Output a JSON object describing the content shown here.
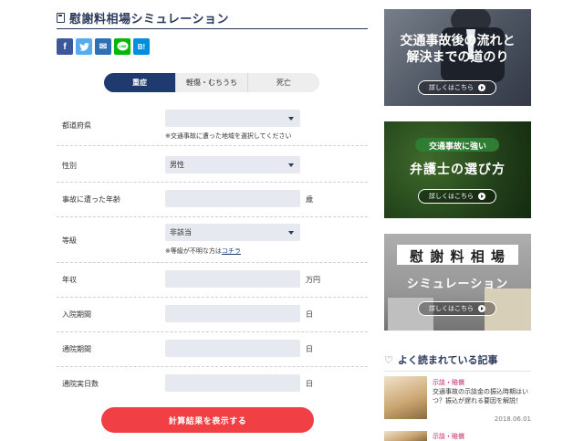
{
  "page_title": "慰謝料相場シミュレーション",
  "share": {
    "facebook": "f",
    "twitter": "t",
    "mail": "✉",
    "line": "LINE",
    "hatena": "B!"
  },
  "tabs": [
    {
      "label": "重症",
      "active": true
    },
    {
      "label": "軽傷・むちうち",
      "active": false
    },
    {
      "label": "死亡",
      "active": false
    }
  ],
  "form": {
    "prefecture": {
      "label": "都道府県",
      "value": "",
      "note": "※交通事故に遭った地域を選択してください"
    },
    "gender": {
      "label": "性別",
      "value": "男性"
    },
    "age": {
      "label": "事故に遭った年齢",
      "value": "",
      "unit": "歳"
    },
    "grade": {
      "label": "等級",
      "value": "非該当",
      "note_prefix": "※等級が不明な方は",
      "note_link": "コチラ"
    },
    "income": {
      "label": "年収",
      "value": "",
      "unit": "万円"
    },
    "hospital_period": {
      "label": "入院期間",
      "value": "",
      "unit": "日"
    },
    "outpatient_period": {
      "label": "通院期間",
      "value": "",
      "unit": "日"
    },
    "outpatient_days": {
      "label": "通院実日数",
      "value": "",
      "unit": "日"
    }
  },
  "submit_label": "計算結果を表示する",
  "sidebar": {
    "banners": [
      {
        "line1": "交通事故後の流れと",
        "line2": "解決までの道のり",
        "button": "詳しくはこちら"
      },
      {
        "line1": "交通事故に強い",
        "line2": "弁護士の選び方",
        "button": "詳しくはこちら"
      },
      {
        "line1": "慰 謝 料 相 場",
        "line2": "シミュレーション",
        "button": "詳しくはこちら"
      }
    ],
    "popular_title": "よく読まれている記事",
    "articles": [
      {
        "category": "示談・賠償",
        "title": "交通事故の示談金の振込時期はいつ？振込が遅れる要因を解説！",
        "date": "2018.06.01"
      },
      {
        "category": "示談・賠償",
        "title": "",
        "date": ""
      }
    ]
  },
  "colors": {
    "navy": "#1f3a6e",
    "submit": "#f04045",
    "field_bg": "#e6e9ef",
    "category": "#c2185b"
  }
}
